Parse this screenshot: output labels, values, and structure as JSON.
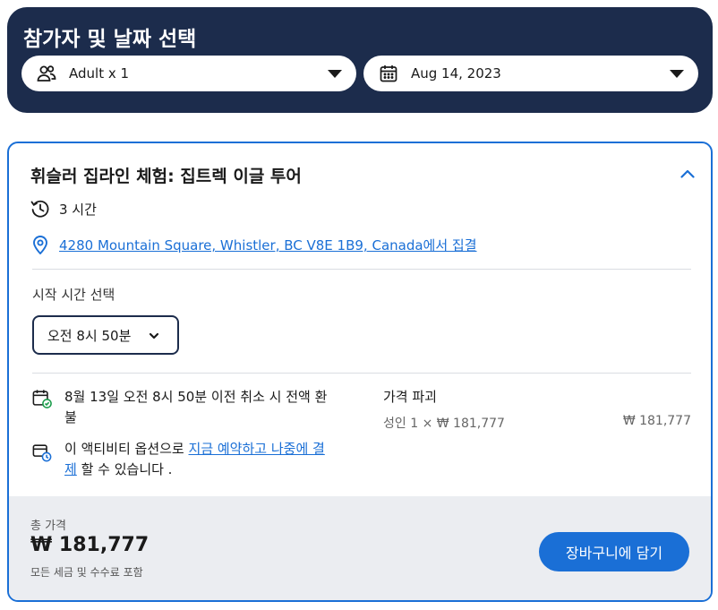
{
  "header": {
    "title": "참가자 및 날짜 선택",
    "guests": {
      "icon": "people-icon",
      "value": "Adult x 1"
    },
    "date": {
      "icon": "calendar-icon",
      "value": "Aug 14, 2023"
    }
  },
  "activity": {
    "title": "휘슬러 집라인 체험: 집트렉 이글 투어",
    "duration": "3 시간",
    "location_link": "4280 Mountain Square, Whistler, BC V8E 1B9, Canada에서 집결",
    "start_time_label": "시작 시간 선택",
    "start_time_value": "오전 8시 50분",
    "cancellation": "8월 13일 오전 8시 50분 이전 취소 시 전액 환불",
    "reserve_prefix": "이 액티비티 옵션으로 ",
    "reserve_link": "지금 예약하고 나중에 결제",
    "reserve_suffix": " 할 수 있습니다 .",
    "price_breakdown_title": "가격 파괴",
    "price_line_label": "성인 1 × ₩ 181,777",
    "price_line_amount": "₩ 181,777"
  },
  "footer": {
    "total_label": "총 가격",
    "total_amount": "₩ 181,777",
    "total_note": "모든 세금 및 수수료 포함",
    "cart_button": "장바구니에 담기"
  },
  "colors": {
    "header_bg": "#1c2c4c",
    "accent": "#1a6fd6",
    "footer_bg": "#ebedf1"
  }
}
